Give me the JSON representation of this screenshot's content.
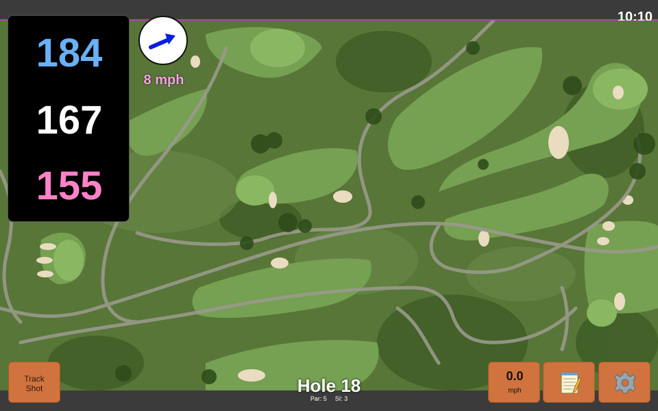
{
  "status": {
    "time": "10:10"
  },
  "distances": {
    "back": "184",
    "middle": "167",
    "front": "155"
  },
  "wind": {
    "speed": "8 mph",
    "icon": "wind-arrow-icon"
  },
  "hole": {
    "title": "Hole 18",
    "par": "Par: 5",
    "si": "SI: 3"
  },
  "buttons": {
    "track_shot": "Track\nShot",
    "speed_value": "0.0",
    "speed_unit": "mph",
    "notes_icon": "notepad-icon",
    "settings_icon": "gear-icon"
  },
  "colors": {
    "back": "#6ab0f5",
    "middle": "#ffffff",
    "front": "#ff82c8",
    "button": "#d0733f",
    "wind_text": "#f7a2e6"
  }
}
